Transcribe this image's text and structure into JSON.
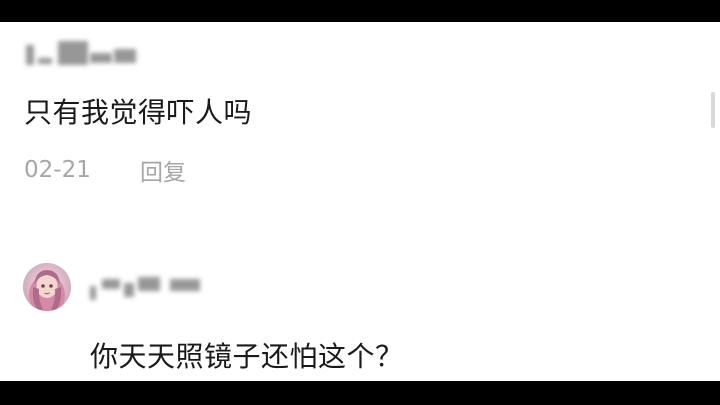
{
  "comments": [
    {
      "text": "只有我觉得吓人吗",
      "date": "02-21",
      "reply_label": "回复"
    },
    {
      "text": "你天天照镜子还怕这个？"
    }
  ],
  "colors": {
    "background": "#ffffff",
    "text": "#1a1a1a",
    "meta": "#a6a6a6",
    "frame": "#000000"
  },
  "icons": {
    "avatar": "avatar-image"
  }
}
